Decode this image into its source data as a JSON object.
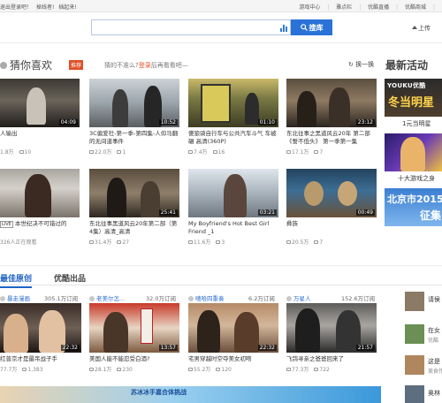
{
  "topbar": {
    "left": [
      "退出登录吧！",
      "掉线者!",
      "插起来!"
    ],
    "right": [
      "游戏中心",
      "雅点栏",
      "优酷直播",
      "优酷商城"
    ]
  },
  "search": {
    "placeholder": "",
    "button": "搜库"
  },
  "upload": {
    "label": "上传"
  },
  "guess": {
    "title": "猜你喜欢",
    "badge": "推荐",
    "hint_prefix": "猜的不准么?",
    "hint_login": "登录",
    "hint_suffix": "后再看看吧—",
    "refresh": "换一换"
  },
  "recent": {
    "title": "最新活动"
  },
  "guess_videos": [
    {
      "title": "人输出",
      "duration": "04:09",
      "plays": "1.8万",
      "comments": "10"
    },
    {
      "title": "3C偏爱社-第一季-第四集-人仰马翻的无间道事件",
      "duration": "10:52",
      "plays": "22.0万",
      "comments": "1"
    },
    {
      "title": "傻狼骑自行车与公共汽车斗气 车被碾 高清(360P)",
      "duration": "01:10",
      "plays": "7.4万",
      "comments": "16"
    },
    {
      "title": "东北往事之黑道风云20年 第二部《誓不低头》 第一季第一集",
      "duration": "23:12",
      "plays": "17.1万",
      "comments": "7"
    },
    {
      "title": "本世纪决不可错过的",
      "duration": "",
      "plays": "326人正在观看",
      "comments": ""
    },
    {
      "title": "东北往事黑道风云20年第二部（第4集）高清_高清",
      "duration": "25:41",
      "plays": "31.4万",
      "comments": "27"
    },
    {
      "title": "My Boyfriend's Hot Best Girl Friend _1",
      "duration": "03:21",
      "plays": "11.6万",
      "comments": "3"
    },
    {
      "title": "彝族",
      "duration": "00:49",
      "plays": "20.5万",
      "comments": "7"
    }
  ],
  "sidebar": {
    "items": [
      {
        "logo": "YOUKU优酷",
        "art": "冬当明星",
        "caption": "1元当明星"
      },
      {
        "caption": "十大游戏之身"
      },
      {
        "art": "北京市2015年",
        "art2": "征集",
        "caption": ""
      }
    ]
  },
  "tabs": {
    "best": "最佳原创",
    "other": "优酷出品"
  },
  "channels": [
    {
      "name": "暴走漫画",
      "subs": "305.1万订阅"
    },
    {
      "name": "老美尔怎...",
      "subs": "32.0万订阅"
    },
    {
      "name": "嘻哈四重奏",
      "subs": "6.2万订阅"
    },
    {
      "name": "万星人",
      "subs": "152.6万订阅"
    }
  ],
  "best_videos": [
    {
      "title": "红普京才是最吊战子手",
      "duration": "22:32",
      "plays": "77.7万",
      "comments": "1,383"
    },
    {
      "title": "美国人能不能忍受白酒?",
      "duration": "13:57",
      "plays": "28.1万",
      "comments": "230"
    },
    {
      "title": "宅男穿越时空夺美女初吻",
      "duration": "22:32",
      "plays": "55.2万",
      "comments": "120"
    },
    {
      "title": "飞鸽寻亲之爸爸回来了",
      "duration": "21:57",
      "plays": "77.3万",
      "comments": "722"
    }
  ],
  "mini_list": [
    {
      "title": "请侯",
      "sub": ""
    },
    {
      "title": "在女",
      "sub": "优酷"
    },
    {
      "title": "这是",
      "sub": "美食作"
    },
    {
      "title": "奥林",
      "sub": ""
    }
  ],
  "banner": {
    "line1": "苏冰冰手嘉合体挑战",
    "line2": ""
  }
}
